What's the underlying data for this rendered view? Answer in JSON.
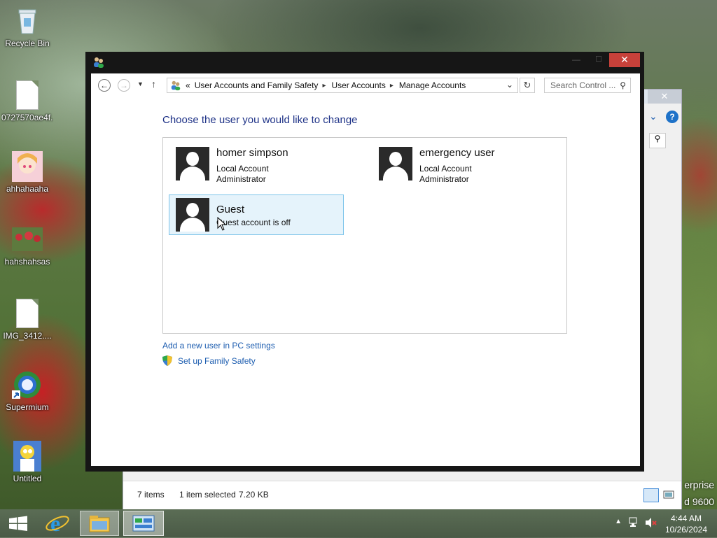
{
  "desktop": {
    "icons": [
      {
        "label": "Recycle Bin"
      },
      {
        "label": "0727570ae4f..."
      },
      {
        "label": "ahhahaaha"
      },
      {
        "label": "hahshahsas"
      },
      {
        "label": "IMG_3412...."
      },
      {
        "label": "Supermium"
      },
      {
        "label": "Untitled"
      }
    ],
    "win_edition": "erprise",
    "win_build": "d 9600"
  },
  "background_window": {
    "status_items": "7 items",
    "status_selected": "1 item selected",
    "status_size": "7.20 KB"
  },
  "window": {
    "title": "",
    "address": {
      "overflow": "«",
      "segments": [
        "User Accounts and Family Safety",
        "User Accounts",
        "Manage Accounts"
      ]
    },
    "search_placeholder": "Search Control ...",
    "heading": "Choose the user you would like to change",
    "users": [
      {
        "name": "homer simpson",
        "line1": "Local Account",
        "line2": "Administrator"
      },
      {
        "name": "emergency user",
        "line1": "Local Account",
        "line2": "Administrator"
      },
      {
        "name": "Guest",
        "line1": "Guest account is off",
        "line2": ""
      }
    ],
    "links": {
      "add_user": "Add a new user in PC settings",
      "family_safety": "Set up Family Safety"
    }
  },
  "taskbar": {
    "time": "4:44 AM",
    "date": "10/26/2024"
  }
}
